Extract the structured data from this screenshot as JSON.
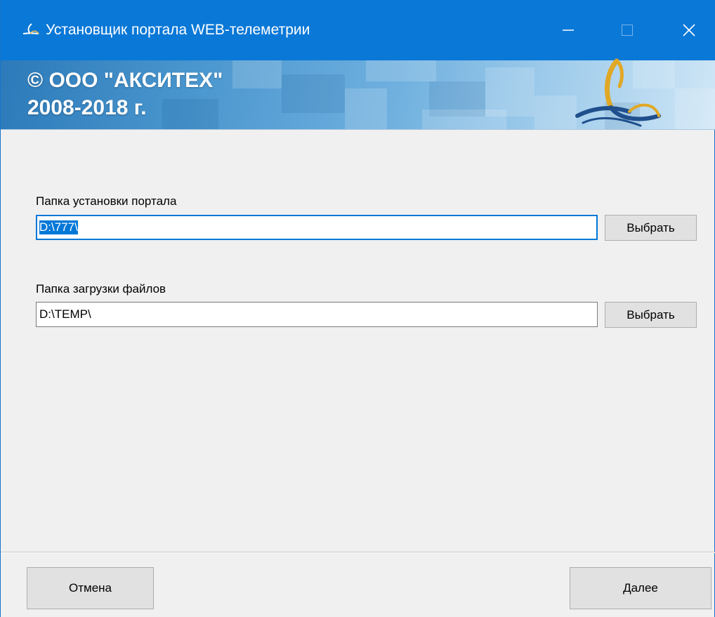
{
  "window": {
    "title": "Установщик портала WEB-телеметрии",
    "app_icon": "axitech-logo-icon",
    "controls": [
      "minimize-icon",
      "maximize-icon",
      "close-icon"
    ]
  },
  "banner": {
    "line1": "© ООО \"АКСИТЕХ\"",
    "line2": "2008-2018 г.",
    "logo": "axitech-logo"
  },
  "form": {
    "install_folder": {
      "label": "Папка установки портала",
      "value": "D:\\777\\",
      "browse_label": "Выбрать"
    },
    "download_folder": {
      "label": "Папка загрузки файлов",
      "value": "D:\\TEMP\\",
      "browse_label": "Выбрать"
    }
  },
  "footer": {
    "cancel_label": "Отмена",
    "next_label": "Далее"
  },
  "colors": {
    "titlebar": "#0a78d7",
    "logo_blue": "#1f4f8c",
    "logo_gold": "#e0a825",
    "selection": "#0078d7"
  }
}
